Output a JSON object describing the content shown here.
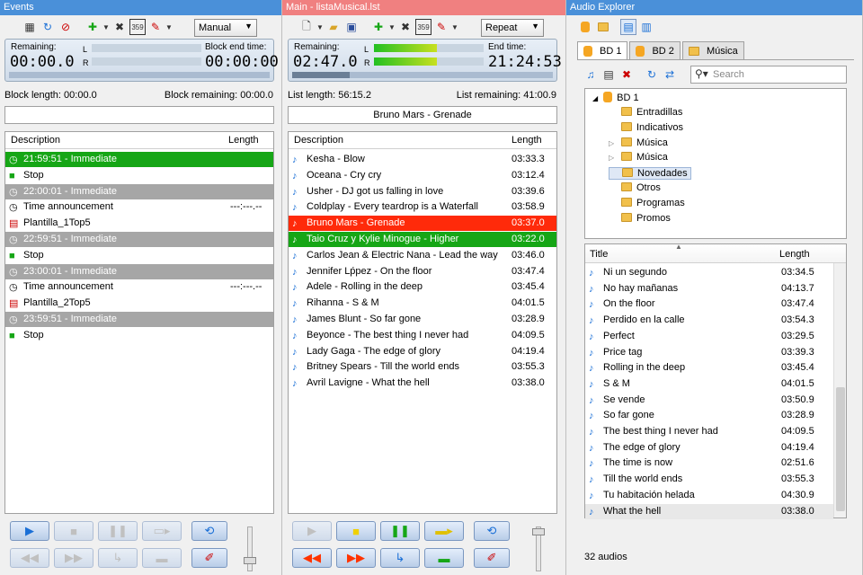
{
  "colors": {
    "playing_green": "#16a616",
    "current_red": "#ff2a0a",
    "inactive_gray": "#a6a6a6",
    "events_title": "#4a90d9",
    "main_title": "#f08080"
  },
  "events": {
    "title": "Events",
    "mode": "Manual",
    "remaining_label": "Remaining:",
    "remaining": "00:00.0",
    "block_end_label": "Block end time:",
    "block_end": "00:00:00",
    "block_length": "Block length: 00:00.0",
    "block_remaining": "Block remaining: 00:00.0",
    "col_description": "Description",
    "col_length": "Length",
    "rows": [
      {
        "icon": "clock-icon",
        "text": "21:59:51 - Immediate",
        "length": "",
        "state": "green"
      },
      {
        "icon": "stop-icon",
        "text": "Stop",
        "length": "",
        "state": "normal"
      },
      {
        "icon": "clock-icon",
        "text": "22:00:01 - Immediate",
        "length": "",
        "state": "gray"
      },
      {
        "icon": "clock-icon",
        "text": "Time announcement",
        "length": "---:---.--",
        "state": "normal"
      },
      {
        "icon": "playlist-icon",
        "text": "Plantilla_1Top5",
        "length": "",
        "state": "normal"
      },
      {
        "icon": "clock-icon",
        "text": "22:59:51 - Immediate",
        "length": "",
        "state": "gray"
      },
      {
        "icon": "stop-icon",
        "text": "Stop",
        "length": "",
        "state": "normal"
      },
      {
        "icon": "clock-icon",
        "text": "23:00:01 - Immediate",
        "length": "",
        "state": "gray"
      },
      {
        "icon": "clock-icon",
        "text": "Time announcement",
        "length": "---:---.--",
        "state": "normal"
      },
      {
        "icon": "playlist-icon",
        "text": "Plantilla_2Top5",
        "length": "",
        "state": "normal"
      },
      {
        "icon": "clock-icon",
        "text": "23:59:51 - Immediate",
        "length": "",
        "state": "gray"
      },
      {
        "icon": "stop-icon",
        "text": "Stop",
        "length": "",
        "state": "normal"
      }
    ]
  },
  "main": {
    "title": "Main - listaMusical.lst",
    "mode": "Repeat",
    "remaining_label": "Remaining:",
    "remaining": "02:47.0",
    "end_time_label": "End time:",
    "end_time": "21:24:53",
    "list_length": "List length: 56:15.2",
    "list_remaining": "List remaining: 41:00.9",
    "now_playing": "Bruno Mars - Grenade",
    "col_description": "Description",
    "col_length": "Length",
    "rows": [
      {
        "text": "Kesha - Blow",
        "length": "03:33.3",
        "state": "normal"
      },
      {
        "text": "Oceana - Cry cry",
        "length": "03:12.4",
        "state": "normal"
      },
      {
        "text": "Usher - DJ got us falling in love",
        "length": "03:39.6",
        "state": "normal"
      },
      {
        "text": "Coldplay - Every teardrop is a Waterfall",
        "length": "03:58.9",
        "state": "normal"
      },
      {
        "text": "Bruno Mars - Grenade",
        "length": "03:37.0",
        "state": "red"
      },
      {
        "text": "Taio Cruz y Kylie Minogue - Higher",
        "length": "03:22.0",
        "state": "green"
      },
      {
        "text": "Carlos Jean & Electric Nana - Lead the way",
        "length": "03:46.0",
        "state": "normal"
      },
      {
        "text": "Jennifer Lṕpez - On the floor",
        "length": "03:47.4",
        "state": "normal"
      },
      {
        "text": "Adele - Rolling in the deep",
        "length": "03:45.4",
        "state": "normal"
      },
      {
        "text": "Rihanna - S & M",
        "length": "04:01.5",
        "state": "normal"
      },
      {
        "text": "James Blunt - So far gone",
        "length": "03:28.9",
        "state": "normal"
      },
      {
        "text": "Beyonce - The best thing I never had",
        "length": "04:09.5",
        "state": "normal"
      },
      {
        "text": "Lady Gaga - The edge of glory",
        "length": "04:19.4",
        "state": "normal"
      },
      {
        "text": "Britney Spears - Till the world ends",
        "length": "03:55.3",
        "state": "normal"
      },
      {
        "text": "Avril Lavigne - What the hell",
        "length": "03:38.0",
        "state": "normal"
      }
    ]
  },
  "explorer": {
    "title": "Audio Explorer",
    "tabs": [
      "BD 1",
      "BD 2",
      "Música"
    ],
    "search_placeholder": "Search",
    "tree_root": "BD 1",
    "tree": [
      {
        "label": "Entradillas",
        "expander": ""
      },
      {
        "label": "Indicativos",
        "expander": ""
      },
      {
        "label": "Música",
        "expander": "▷"
      },
      {
        "label": "Música",
        "expander": "▷"
      },
      {
        "label": "Novedades",
        "expander": ""
      },
      {
        "label": "Otros",
        "expander": ""
      },
      {
        "label": "Programas",
        "expander": ""
      },
      {
        "label": "Promos",
        "expander": ""
      }
    ],
    "col_title": "Title",
    "col_length": "Length",
    "rows": [
      {
        "title": "Ni un segundo",
        "length": "03:34.5"
      },
      {
        "title": "No hay mañanas",
        "length": "04:13.7"
      },
      {
        "title": "On the floor",
        "length": "03:47.4"
      },
      {
        "title": "Perdido en la calle",
        "length": "03:54.3"
      },
      {
        "title": "Perfect",
        "length": "03:29.5"
      },
      {
        "title": "Price tag",
        "length": "03:39.3"
      },
      {
        "title": "Rolling in the deep",
        "length": "03:45.4"
      },
      {
        "title": "S & M",
        "length": "04:01.5"
      },
      {
        "title": "Se vende",
        "length": "03:50.9"
      },
      {
        "title": "So far gone",
        "length": "03:28.9"
      },
      {
        "title": "The best thing I never had",
        "length": "04:09.5"
      },
      {
        "title": "The edge of glory",
        "length": "04:19.4"
      },
      {
        "title": "The time is now",
        "length": "02:51.6"
      },
      {
        "title": "Till the world ends",
        "length": "03:55.3"
      },
      {
        "title": "Tu habitación helada",
        "length": "04:30.9"
      },
      {
        "title": "What the hell",
        "length": "03:38.0"
      }
    ],
    "count": "32 audios"
  }
}
